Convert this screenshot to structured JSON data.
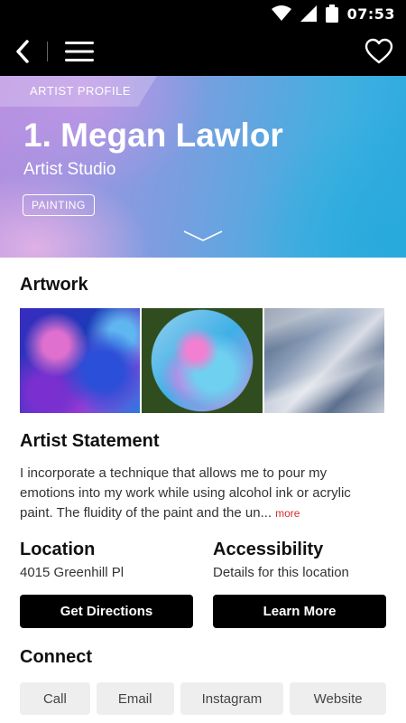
{
  "status_bar": {
    "time": "07:53",
    "icons": [
      "wifi-icon",
      "signal-icon",
      "battery-icon"
    ]
  },
  "app_bar": {
    "icons": [
      "back-icon",
      "menu-icon",
      "heart-icon"
    ]
  },
  "hero": {
    "tag": "ARTIST PROFILE",
    "name": "1. Megan Lawlor",
    "studio": "Artist Studio",
    "badge": "PAINTING",
    "chevron_icon": "chevron-down-icon"
  },
  "artwork": {
    "heading": "Artwork",
    "images": [
      "artwork-1",
      "artwork-2",
      "artwork-3"
    ]
  },
  "statement": {
    "heading": "Artist Statement",
    "text": "I incorporate a technique that allows me to pour my emotions into my work while using alcohol ink or acrylic paint. The fluidity of the paint and the un...",
    "more": "more"
  },
  "location": {
    "heading": "Location",
    "value": "4015 Greenhill Pl",
    "button": "Get Directions"
  },
  "accessibility": {
    "heading": "Accessibility",
    "value": "Details for this location",
    "button": "Learn More"
  },
  "connect": {
    "heading": "Connect",
    "chips": [
      "Call",
      "Email",
      "Instagram",
      "Website"
    ]
  },
  "colors": {
    "accent_more": "#d0312d",
    "button_bg": "#000000",
    "chip_bg": "#eeeeee"
  }
}
